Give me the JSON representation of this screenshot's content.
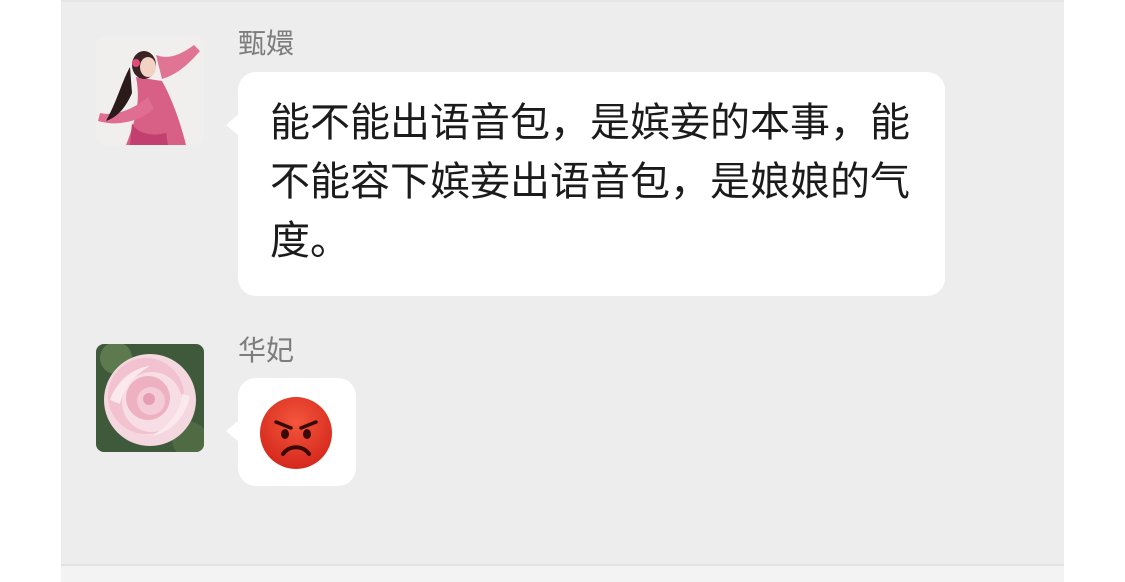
{
  "messages": [
    {
      "sender": "甄嬛",
      "avatar": "woman-in-pink-dress-avatar",
      "text": "能不能出语音包，是嫔妾的本事，能不能容下嫔妾出语音包，是娘娘的气度。"
    },
    {
      "sender": "华妃",
      "avatar": "pink-peony-flower-avatar",
      "emoji": "angry-face-emoji"
    }
  ],
  "colors": {
    "chat_background": "#ededed",
    "bubble": "#ffffff",
    "sender_name": "#7d7d7d",
    "message_text": "#1b1b1b",
    "angry_face": "#e0301e"
  }
}
